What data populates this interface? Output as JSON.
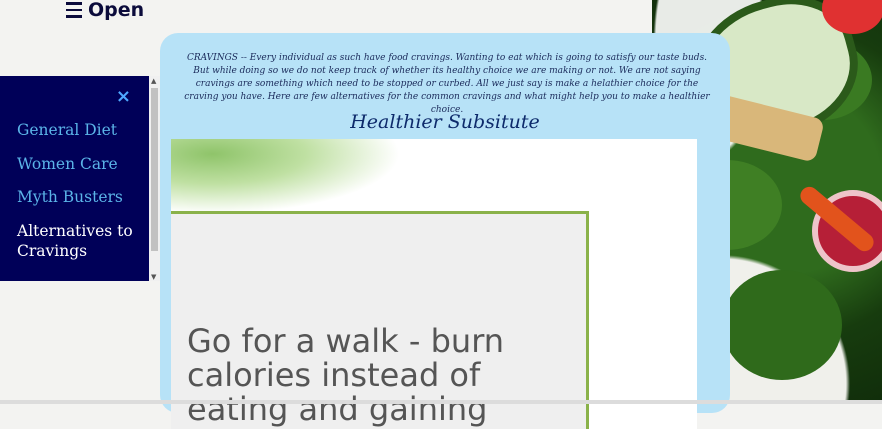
{
  "header": {
    "toggle_label": "Open"
  },
  "sidebar": {
    "close_symbol": "×",
    "items": [
      {
        "label": "General Diet",
        "active": false
      },
      {
        "label": "Women Care",
        "active": false
      },
      {
        "label": "Myth Busters",
        "active": false
      },
      {
        "label": "Alternatives to Cravings",
        "active": true
      }
    ]
  },
  "main": {
    "intro": "CRAVINGS -- Every individual as such have food cravings. Wanting to eat which is going to satisfy our taste buds. But while doing so we do not keep track of whether its healthy choice we are making or not. We are not saying cravings are something which need to be stopped or curbed. All we just say is make a helathier choice for the craving you have. Here are few alternatives for the common cravings and what might help you to make a healthier choice.",
    "heading": "Healthier Subsitute",
    "card_text": "Go for a walk - burn calories instead of eating and gaining"
  },
  "colors": {
    "sidebar_bg": "#000058",
    "sidebar_link": "#5bb4e8",
    "sidebar_active": "#ffffff",
    "panel_bg": "#b7e2f7",
    "card_border": "#8ab24a"
  }
}
